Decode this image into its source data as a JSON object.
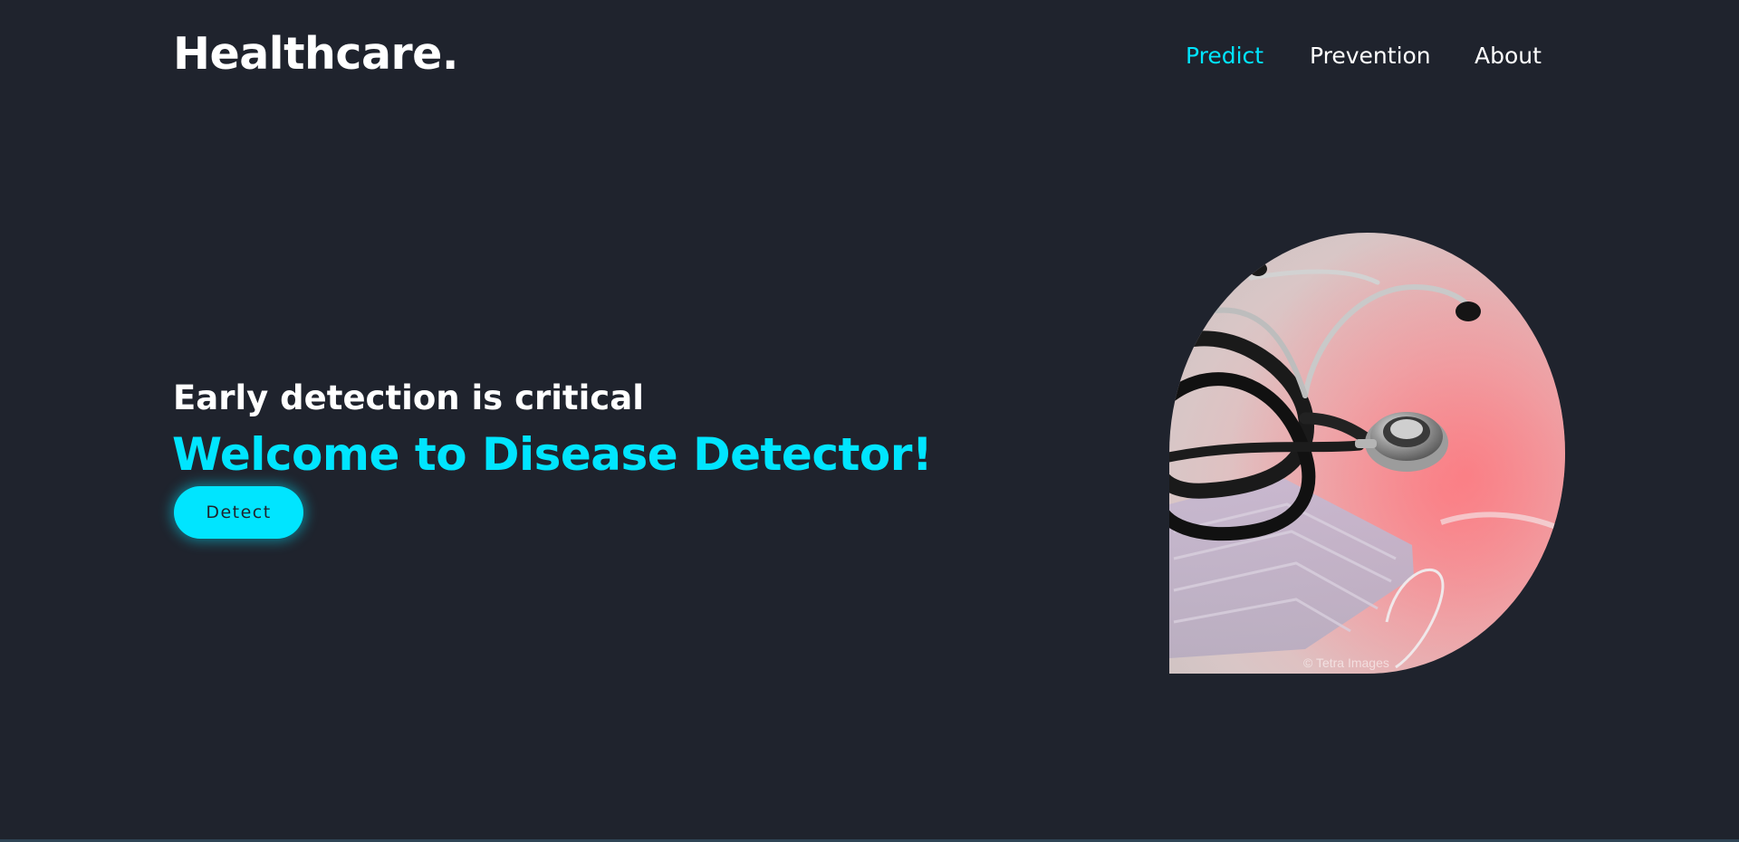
{
  "header": {
    "logo": "Healthcare.",
    "nav": [
      {
        "label": "Predict",
        "active": true
      },
      {
        "label": "Prevention",
        "active": false
      },
      {
        "label": "About",
        "active": false
      }
    ]
  },
  "hero": {
    "subtitle": "Early detection is critical",
    "title": "Welcome to Disease Detector!",
    "button_label": "Detect",
    "image": {
      "subject": "stethoscope-on-surgical-mask",
      "watermark": "© Tetra Images"
    }
  },
  "colors": {
    "background": "#1f232d",
    "accent": "#00e5ff",
    "text": "#ffffff"
  }
}
